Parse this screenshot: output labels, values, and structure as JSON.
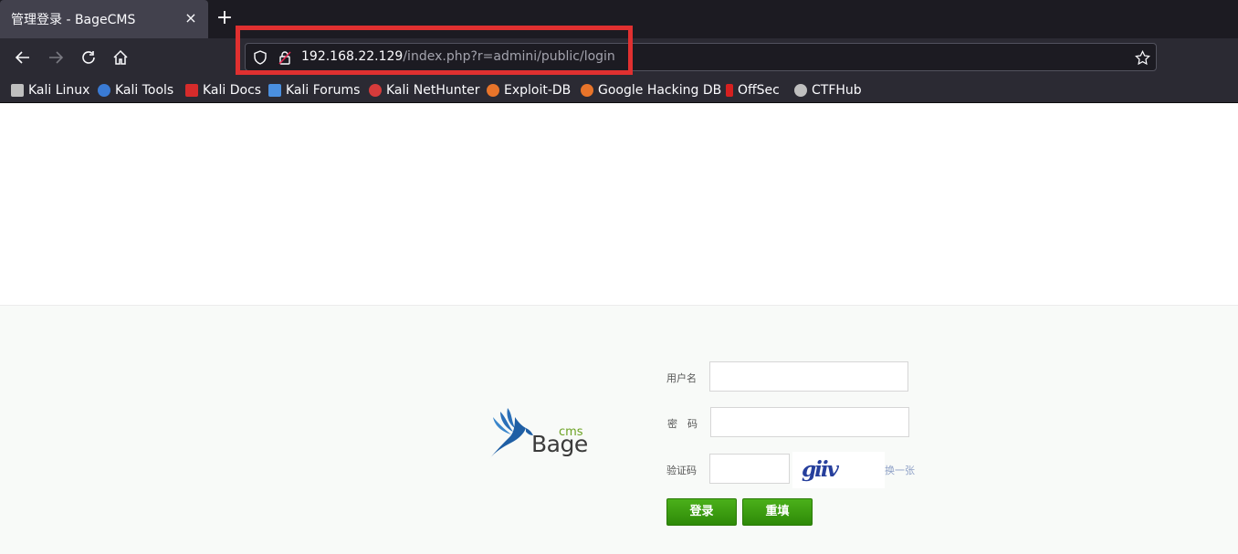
{
  "browser": {
    "tab_title": "管理登录 - BageCMS",
    "tab_close": "×",
    "new_tab": "+",
    "url_host": "192.168.22.129",
    "url_path": "/index.php?r=admini/public/login",
    "bookmarks": [
      {
        "label": "Kali Linux",
        "icon": "kali-dragon-icon",
        "color": "#c8c8c8"
      },
      {
        "label": "Kali Tools",
        "icon": "kali-tools-icon",
        "color": "#3a7bd5"
      },
      {
        "label": "Kali Docs",
        "icon": "kali-docs-icon",
        "color": "#d62b2b"
      },
      {
        "label": "Kali Forums",
        "icon": "kali-forums-icon",
        "color": "#4a8fdf"
      },
      {
        "label": "Kali NetHunter",
        "icon": "nethunter-icon",
        "color": "#d63b3b"
      },
      {
        "label": "Exploit-DB",
        "icon": "exploit-db-icon",
        "color": "#e8742a"
      },
      {
        "label": "Google Hacking DB",
        "icon": "ghdb-icon",
        "color": "#e8742a"
      },
      {
        "label": "OffSec",
        "icon": "offsec-icon",
        "color": "#d62020"
      },
      {
        "label": "CTFHub",
        "icon": "ctfhub-icon",
        "color": "#bfbfbf"
      }
    ]
  },
  "login": {
    "logo_cms": "cms",
    "logo_bage": "Bage",
    "username_label": "用户名",
    "password_label": "密　码",
    "captcha_label": "验证码",
    "username_value": "",
    "password_value": "",
    "captcha_value": "",
    "captcha_image_text": "giiv",
    "change_link": "换一张",
    "submit_label": "登录",
    "reset_label": "重填"
  },
  "colors": {
    "chrome_dark": "#1c1b22",
    "chrome_mid": "#2b2a33",
    "highlight": "#e03030",
    "button_green": "#3a9c10",
    "logo_blue": "#2a6fb8",
    "logo_green": "#6aa121"
  }
}
